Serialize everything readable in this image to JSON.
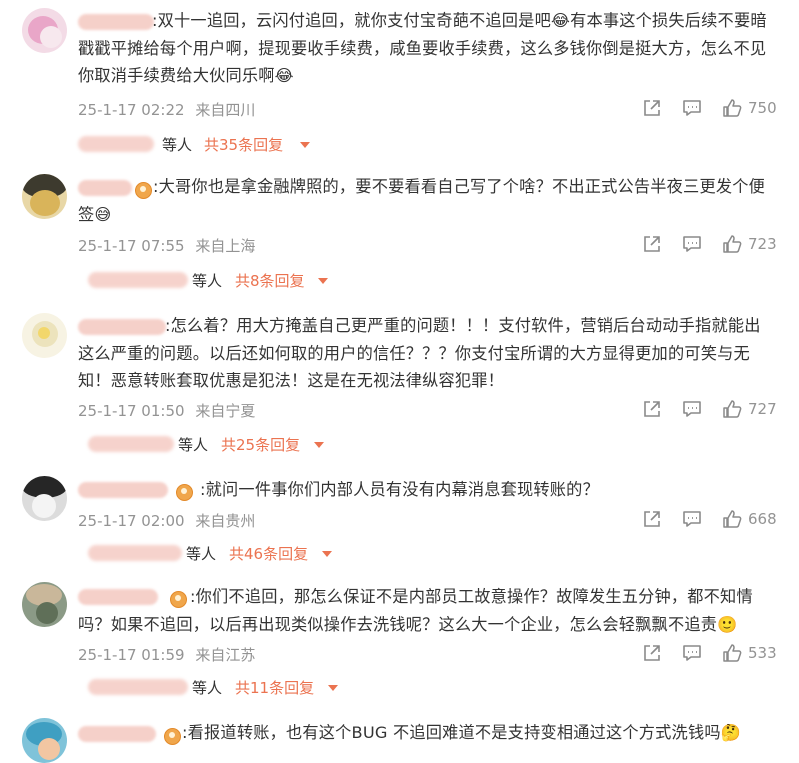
{
  "comments": [
    {
      "lines": [
        ":双十一追回，云闪付追回，就你支付宝奇葩不追回是吧😂有本事这个损失后续不要暗",
        "戳戳平摊给每个用户啊，提现要收手续费，咸鱼要收手续费，这么多钱你倒是挺大方，怎么不见",
        "你取消手续费给大伙同乐啊😂"
      ],
      "time": "25-1-17 02:22",
      "location": "来自四川",
      "likes": "750",
      "reply_etc": "等人",
      "reply_link": "共35条回复"
    },
    {
      "lines": [
        ":大哥你也是拿金融牌照的，要不要看看自己写了个啥？不出正式公告半夜三更发个便",
        "签😅"
      ],
      "time": "25-1-17 07:55",
      "location": "来自上海",
      "likes": "723",
      "reply_etc": "等人",
      "reply_link": "共8条回复"
    },
    {
      "lines": [
        ":怎么着？用大方掩盖自己更严重的问题！！！支付软件，营销后台动动手指就能出",
        "这么严重的问题。以后还如何取的用户的信任？？？你支付宝所谓的大方显得更加的可笑与无",
        "知！恶意转账套取优惠是犯法！这是在无视法律纵容犯罪！"
      ],
      "time": "25-1-17 01:50",
      "location": "来自宁夏",
      "likes": "727",
      "reply_etc": "等人",
      "reply_link": "共25条回复"
    },
    {
      "lines": [
        ":就问一件事你们内部人员有没有内幕消息套现转账的？"
      ],
      "time": "25-1-17 02:00",
      "location": "来自贵州",
      "likes": "668",
      "reply_etc": "等人",
      "reply_link": "共46条回复"
    },
    {
      "lines": [
        ":你们不追回，那怎么保证不是内部员工故意操作？故障发生五分钟，都不知情",
        "吗？如果不追回，以后再出现类似操作去洗钱呢？这么大一个企业，怎么会轻飘飘不追责🙂"
      ],
      "time": "25-1-17 01:59",
      "location": "来自江苏",
      "likes": "533",
      "reply_etc": "等人",
      "reply_link": "共11条回复"
    },
    {
      "lines": [
        ":看报道转账，也有这个BUG 不追回难道不是支持变相通过这个方式洗钱吗🤔"
      ]
    }
  ],
  "icons": {
    "share": "share-icon",
    "comment": "comment-icon",
    "like": "thumbs-up-icon",
    "badge": "fan-badge-icon",
    "caret": "caret-down-icon"
  },
  "colors": {
    "accent": "#eb7350",
    "meta": "#939393",
    "text": "#333333"
  }
}
